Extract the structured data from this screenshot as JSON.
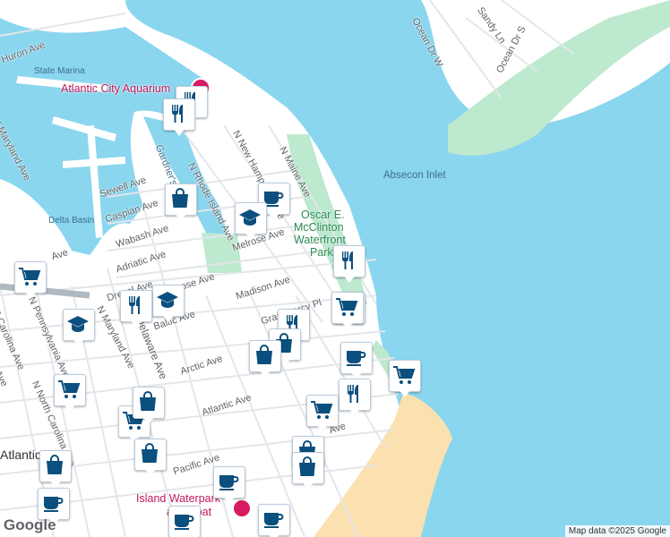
{
  "map": {
    "water_labels": [
      "Absecon Inlet",
      "State Marina",
      "Delta Basin"
    ],
    "park_labels": [
      "Oscar E.",
      "McClinton",
      "Waterfront",
      "Park"
    ],
    "poi_labels": [
      "Atlantic City Aquarium",
      "Island Waterpark",
      "and Boat"
    ],
    "place_labels": [
      "Atlantic City"
    ],
    "street_labels": [
      "Ocean Dr W",
      "Ocean Dr S",
      "Sandy Ln",
      "Huron Ave",
      "N Maryland Ave",
      "Sewell Ave",
      "Caspian Ave",
      "Wabash Ave",
      "Adriatic Ave",
      "Drexel Ave",
      "Melrose Ave",
      "Melrose Ave",
      "Madison Ave",
      "Baltic Ave",
      "Arctic Ave",
      "Atlantic Ave",
      "Pacific Ave",
      "N Rhode Island Ave",
      "N New Hampshire Ave",
      "N Maine Ave",
      "Gardner's Basin",
      "N Maryland Ave",
      "Delaware Ave",
      "N Pennsylvania Ave",
      "N North Carolina Ave",
      "S Carolina Ave",
      "Ave",
      "Ave",
      "Grammercy Pl",
      "Ave"
    ],
    "markers": [
      "restaurant",
      "restaurant",
      "shopping",
      "cafe",
      "school",
      "shopping-cart",
      "restaurant",
      "school",
      "shopping-cart",
      "restaurant",
      "school",
      "shopping-cart",
      "restaurant",
      "shopping",
      "shopping",
      "cafe",
      "shopping-cart",
      "shopping-cart",
      "restaurant",
      "shopping-cart",
      "shopping",
      "shopping-cart",
      "shopping",
      "shopping",
      "shopping",
      "shopping",
      "cafe",
      "cafe",
      "cafe",
      "cafe"
    ],
    "colors": {
      "water": "#8ad6ee",
      "land": "#ffffff",
      "park": "#bde9cf",
      "beach": "#fbe0b0",
      "icon": "#0b4f7e"
    }
  },
  "footer": {
    "logo": "Google",
    "attribution": "Map data ©2025 Google"
  }
}
